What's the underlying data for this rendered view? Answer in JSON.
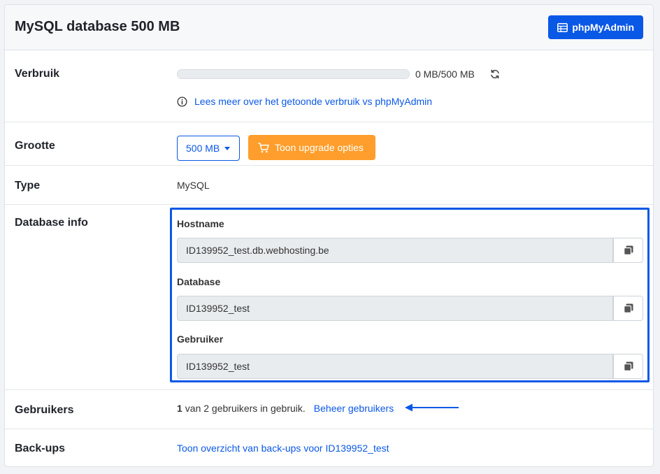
{
  "header": {
    "title": "MySQL database 500 MB",
    "phpmyadmin_label": "phpMyAdmin"
  },
  "usage": {
    "label": "Verbruik",
    "progress_fraction": 0,
    "text": "0 MB/500 MB",
    "info_link": "Lees meer over het getoonde verbruik vs phpMyAdmin"
  },
  "size": {
    "label": "Grootte",
    "selected": "500 MB",
    "upgrade_label": "Toon upgrade opties"
  },
  "type": {
    "label": "Type",
    "value": "MySQL"
  },
  "dbinfo": {
    "label": "Database info",
    "fields": [
      {
        "label": "Hostname",
        "value": "ID139952_test.db.webhosting.be"
      },
      {
        "label": "Database",
        "value": "ID139952_test"
      },
      {
        "label": "Gebruiker",
        "value": "ID139952_test"
      }
    ]
  },
  "users": {
    "label": "Gebruikers",
    "count": "1",
    "text": "van 2 gebruikers in gebruik.",
    "manage_link": "Beheer gebruikers"
  },
  "backups": {
    "label": "Back-ups",
    "link": "Toon overzicht van back-ups voor ID139952_test"
  },
  "colors": {
    "accent": "#0a58e6",
    "upgrade": "#ff9e2c",
    "field_bg": "#e9ecef"
  },
  "icons": [
    "table-icon",
    "refresh-icon",
    "info-icon",
    "cart-icon",
    "copy-icon",
    "arrow-left-icon"
  ]
}
